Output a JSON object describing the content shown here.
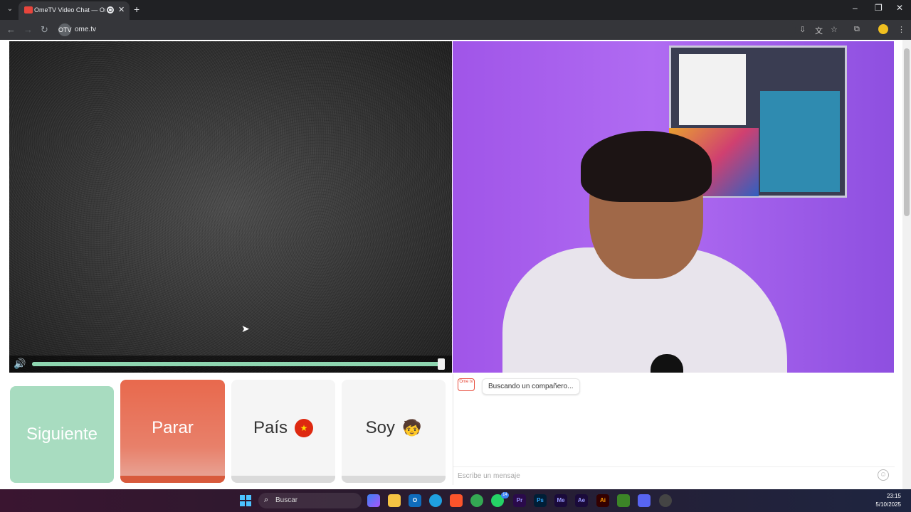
{
  "browser": {
    "tab_title": "OmeTV Video Chat — Ome",
    "new_tab": "+",
    "url": "ome.tv",
    "site_icon_text": "OTV"
  },
  "page": {
    "buttons": {
      "next": "Siguiente",
      "stop": "Parar",
      "country": "País",
      "gender": "Soy"
    },
    "country_flag_glyph": "★",
    "gender_emoji": "🧒",
    "volume_percent": 100,
    "chat": {
      "logo_text": "Ome tv",
      "status_message": "Buscando un compañero...",
      "input_placeholder": "Escribe un mensaje",
      "emoji_glyph": "☺"
    }
  },
  "taskbar": {
    "search_label": "Buscar",
    "whatsapp_badge": "14",
    "time": "23:15",
    "date": "5/10/2025"
  },
  "colors": {
    "next_button": "#a8dcc0",
    "stop_button": "#e8694d",
    "volume_bar": "#8ed6b0",
    "accent_purple": "#a055e8"
  }
}
